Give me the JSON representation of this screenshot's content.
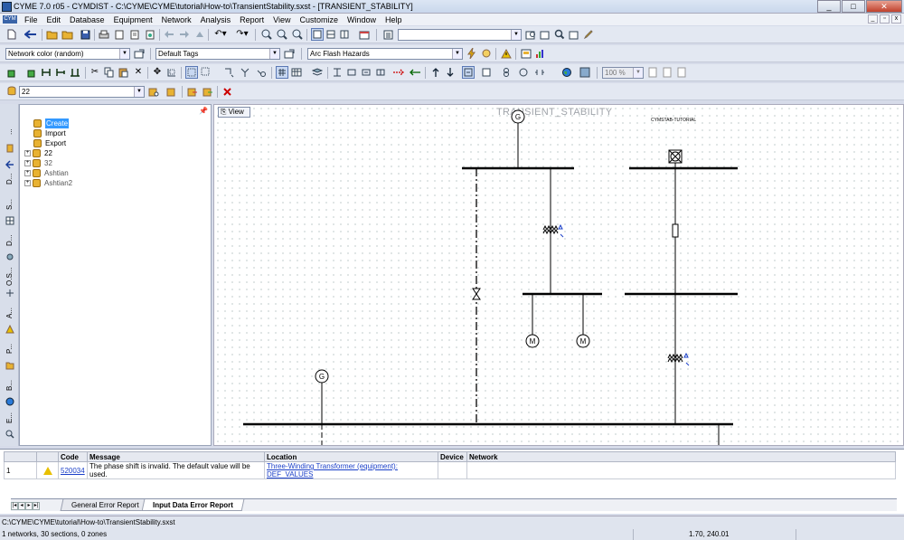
{
  "window": {
    "title": "CYME 7.0 r05 - CYMDIST - C:\\CYME\\CYME\\tutorial\\How-to\\TransientStability.sxst - [TRANSIENT_STABILITY]",
    "minimize": "_",
    "maximize": "□",
    "close": "✕"
  },
  "menu": {
    "logo": "CYM",
    "items": [
      "File",
      "Edit",
      "Database",
      "Equipment",
      "Network",
      "Analysis",
      "Report",
      "View",
      "Customize",
      "Window",
      "Help"
    ],
    "mdi_min": "_",
    "mdi_restore": "▫",
    "mdi_close": "x"
  },
  "toolbars": {
    "network_color": "Network color (random)",
    "tags": "Default Tags",
    "arc_flash": "Arc Flash Hazards",
    "search_value": "",
    "zoom": "100 %",
    "study": "22"
  },
  "left_tabs": [
    {
      "label": "..."
    },
    {
      "label": "D..."
    },
    {
      "label": "S..."
    },
    {
      "label": "D..."
    },
    {
      "label": "O.S..."
    },
    {
      "label": "A..."
    },
    {
      "label": "P..."
    },
    {
      "label": "B..."
    },
    {
      "label": "E..."
    }
  ],
  "tree": {
    "items": [
      {
        "label": "Create",
        "selected": true
      },
      {
        "label": "Import"
      },
      {
        "label": "Export"
      },
      {
        "label": "22"
      },
      {
        "label": "32"
      },
      {
        "label": "Ashtian"
      },
      {
        "label": "Ashtian2"
      }
    ],
    "expander": "+"
  },
  "canvas": {
    "view_button": "View",
    "title": "TRANSIENT_STABILITY",
    "subtitle": "CYMSTAB-TUTORIAL",
    "gen_label": "G",
    "motor_label": "M"
  },
  "errors": {
    "columns": [
      "",
      "",
      "Code",
      "Message",
      "Location",
      "Device",
      "Network"
    ],
    "rows": [
      {
        "num": "1",
        "code": "520034",
        "message": "The phase shift is invalid. The default value will be used.",
        "location": "Three-Winding Transformer (equipment): DEF_VALUES",
        "device": "",
        "network": ""
      }
    ],
    "tabs": [
      "General Error Report",
      "Input Data Error Report"
    ],
    "active_tab": "Input Data Error Report"
  },
  "status": {
    "path": "C:\\CYME\\CYME\\tutorial\\How-to\\TransientStability.sxst",
    "network_info": "1 networks, 30 sections, 0 zones",
    "coords": "1.70, 240.01"
  },
  "colors": {
    "selection": "#3399ff",
    "link": "#1a3fc8",
    "warning": "#e8c000",
    "folder": "#e8b232"
  }
}
